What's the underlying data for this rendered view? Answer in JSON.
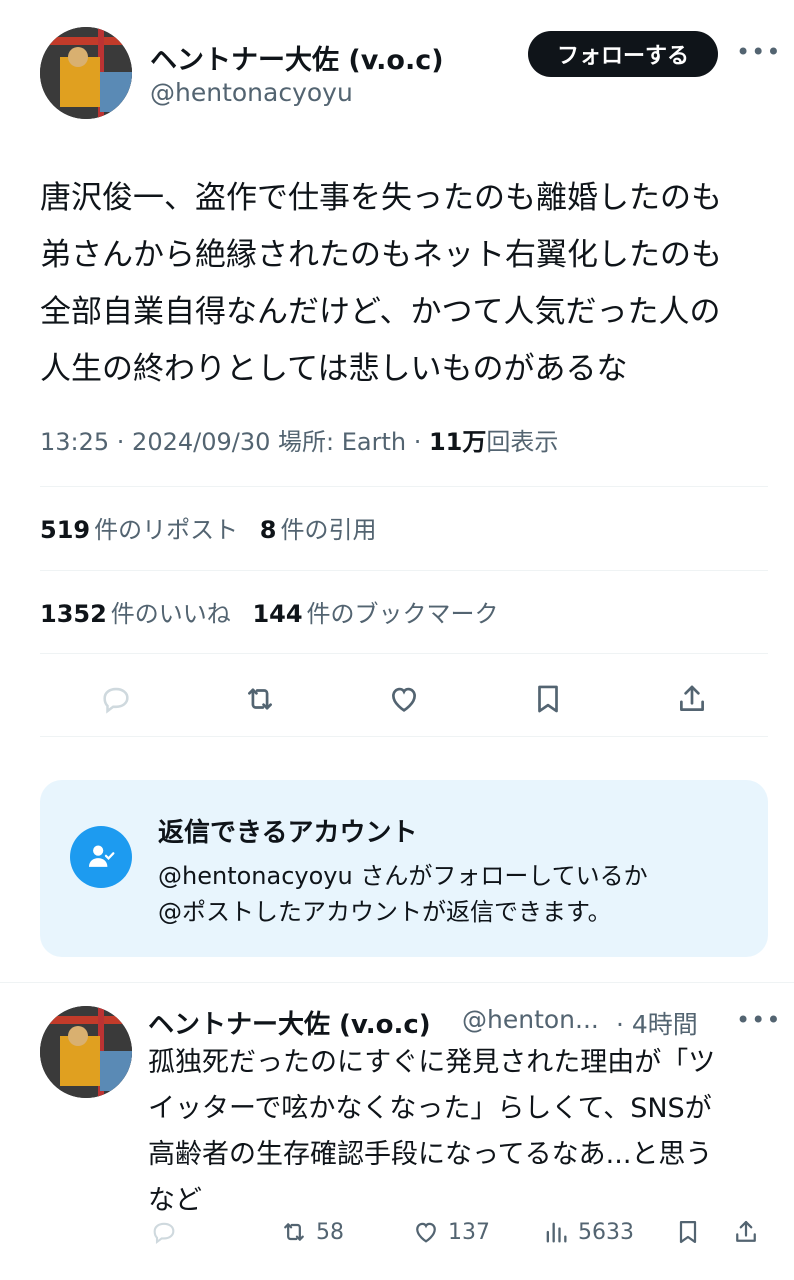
{
  "tweet": {
    "author_name": "ヘントナー大佐 (v.o.c)",
    "author_handle": "@hentonacyoyu",
    "follow_label": "フォローする",
    "text_lines": [
      "唐沢俊一、盗作で仕事を失ったのも離婚したのも",
      "弟さんから絶縁されたのもネット右翼化したのも",
      "全部自業自得なんだけど、かつて人気だった人の",
      "人生の終わりとしては悲しいものがあるな"
    ],
    "meta_prefix": "13:25 · 2024/09/30 場所: Earth · ",
    "views_value": "11万",
    "views_label": "回表示",
    "reposts_value": "519",
    "reposts_label": "件のリポスト",
    "quotes_value": "8",
    "quotes_label": "件の引用",
    "likes_value": "1352",
    "likes_label": "件のいいね",
    "bookmarks_value": "144",
    "bookmarks_label": "件のブックマーク"
  },
  "reply_restriction": {
    "title": "返信できるアカウント",
    "line1": "@hentonacyoyu さんがフォローしているか",
    "line2": "@ポストしたアカウントが返信できます。"
  },
  "reply": {
    "author_name": "ヘントナー大佐 (v.o.c)",
    "author_handle": "@henton...",
    "time": "· 4時間",
    "text_lines": [
      "孤独死だったのにすぐに発見された理由が「ツ",
      "イッターで呟かなくなった」らしくて、SNSが",
      "高齢者の生存確認手段になってるなあ...と思う",
      "など"
    ],
    "retweets": "58",
    "likes": "137",
    "views": "5633"
  },
  "icons": [
    "more-icon",
    "reply-icon",
    "retweet-icon",
    "like-icon",
    "bookmark-icon",
    "share-icon",
    "user-check-icon",
    "views-icon"
  ],
  "colors": {
    "text": "#0f1419",
    "secondary": "#536471",
    "accent": "#1d9bf0",
    "card_bg": "#e8f5fd"
  }
}
